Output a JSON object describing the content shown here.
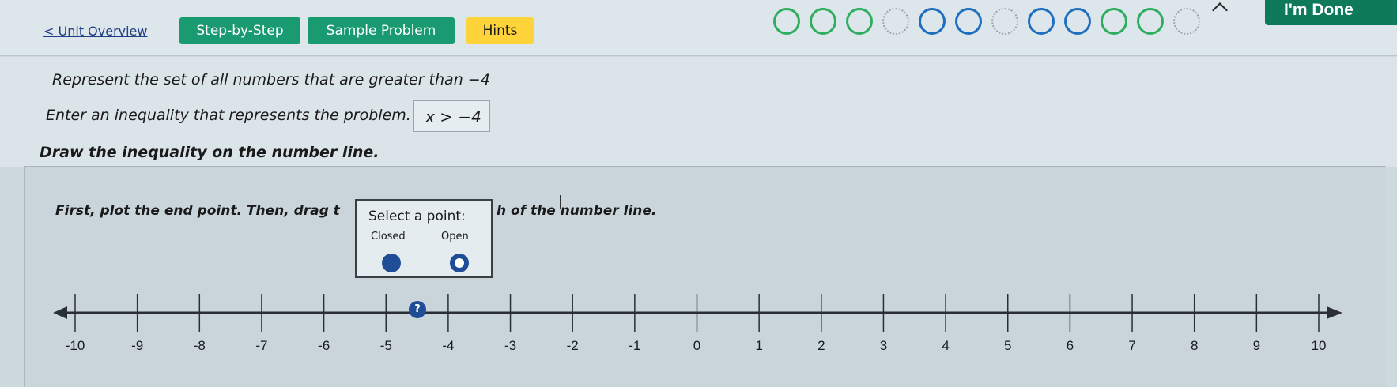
{
  "header": {
    "back_link": "< Unit Overview",
    "tabs": [
      {
        "label": "Step-by-Step"
      },
      {
        "label": "Sample Problem"
      },
      {
        "label": "Hints"
      }
    ],
    "done_label": "I'm Done",
    "progress_total": 12,
    "progress_colors": {
      "green": "#2fae62",
      "blue": "#1f6fc0",
      "gray": "#9aa6ab"
    }
  },
  "problem": {
    "prompt": "Represent the set of all numbers that are greater than −4",
    "enter_label": "Enter an inequality that represents the problem.",
    "answer": "x > −4",
    "draw_label": "Draw the inequality on the number line."
  },
  "instruction": {
    "underlined": "First, plot the end point.",
    "middle": " Then, drag t",
    "tail": "h of the number line."
  },
  "popup": {
    "title": "Select a point:",
    "closed_label": "Closed",
    "open_label": "Open"
  },
  "numberline": {
    "min": -10,
    "max": 10,
    "labels": [
      "-10",
      "-9",
      "-8",
      "-7",
      "-6",
      "-5",
      "-4",
      "-3",
      "-2",
      "-1",
      "0",
      "1",
      "2",
      "3",
      "4",
      "5",
      "6",
      "7",
      "8",
      "9",
      "10"
    ],
    "marker_symbol": "?",
    "line_color": "#2a2f33"
  }
}
